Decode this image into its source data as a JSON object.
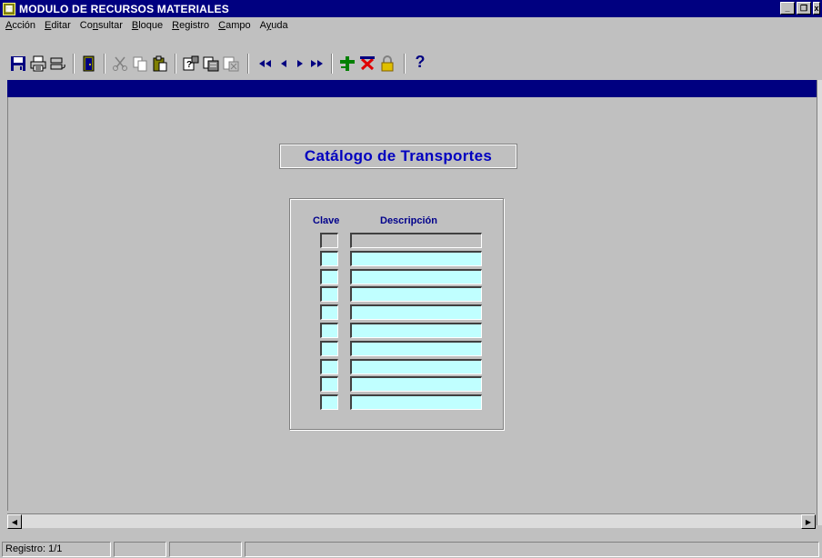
{
  "window": {
    "title": "MODULO DE RECURSOS MATERIALES",
    "minimize_glyph": "_",
    "restore_glyph": "❐",
    "close_glyph": "x"
  },
  "menu": {
    "items": [
      {
        "pre": "",
        "u": "A",
        "post": "cción"
      },
      {
        "pre": "",
        "u": "E",
        "post": "ditar"
      },
      {
        "pre": "Co",
        "u": "n",
        "post": "sultar"
      },
      {
        "pre": "",
        "u": "B",
        "post": "loque"
      },
      {
        "pre": "",
        "u": "R",
        "post": "egistro"
      },
      {
        "pre": "",
        "u": "C",
        "post": "ampo"
      },
      {
        "pre": "A",
        "u": "y",
        "post": "uda"
      }
    ]
  },
  "toolbar": {
    "icons": [
      "save-icon",
      "print-icon",
      "print-setup-icon",
      "exit-icon",
      "cut-icon",
      "copy-icon",
      "paste-icon",
      "enter-query-icon",
      "execute-query-icon",
      "cancel-query-icon",
      "first-record-icon",
      "previous-record-icon",
      "next-record-icon",
      "last-record-icon",
      "insert-record-icon",
      "delete-record-icon",
      "lock-record-icon",
      "help-icon"
    ],
    "help_glyph": "?"
  },
  "form": {
    "title": "Catálogo de Transportes",
    "columns": {
      "clave": "Clave",
      "descripcion": "Descripción"
    },
    "row_count": 10
  },
  "scrollbar": {
    "left_glyph": "◀",
    "right_glyph": "▶"
  },
  "status": {
    "record": "Registro: 1/1"
  },
  "colors": {
    "title_bar": "#000080",
    "window_bg": "#c0c0c0",
    "field_bg": "#c0ffff",
    "form_title": "#0000c0",
    "column_header": "#00008b"
  }
}
